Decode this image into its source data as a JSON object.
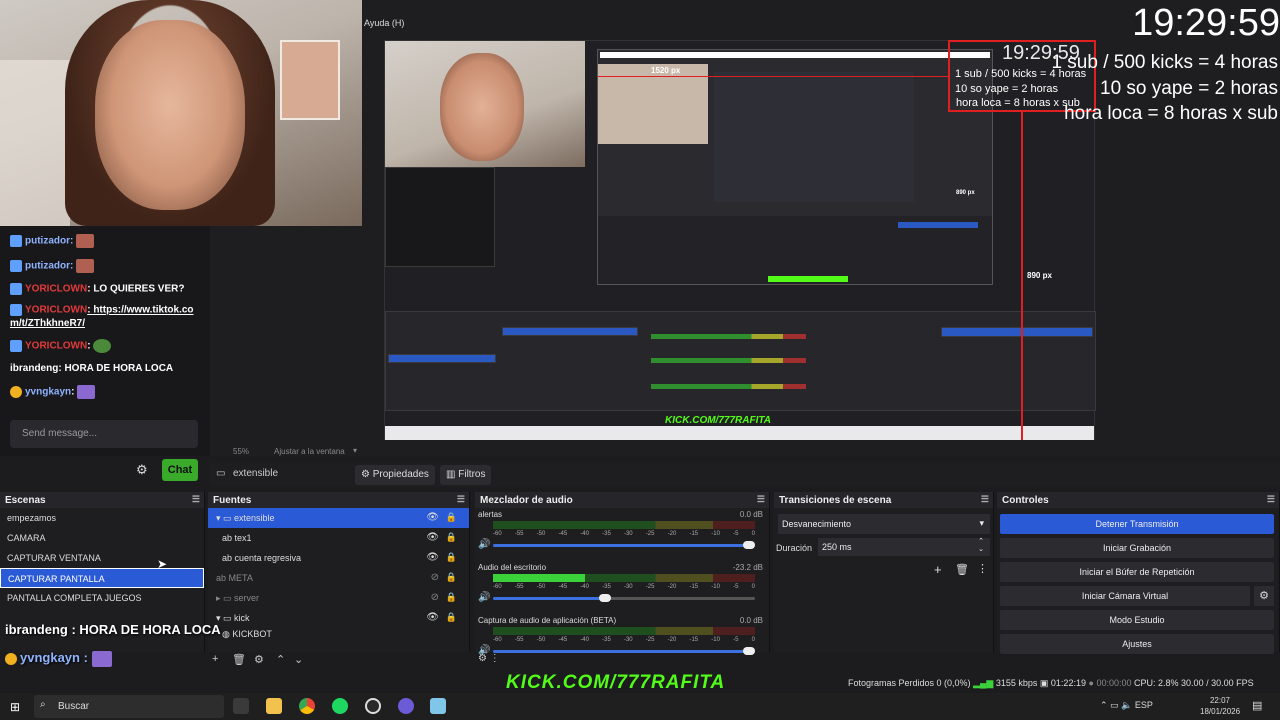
{
  "menubar": {
    "help": "Ayuda (H)"
  },
  "timer": {
    "time": "19:29:59",
    "rule1": "1 sub / 500 kicks = 4 horas",
    "rule2": "10 so yape = 2 horas",
    "rule3": "hora loca = 8 horas x sub"
  },
  "preview_labels": {
    "width_px": "1520 px",
    "height_px": "890 px",
    "height_px_small": "890 px"
  },
  "chat": {
    "messages": [
      {
        "user": "putizador:",
        "text": "",
        "user_color": "#8fb3ff"
      },
      {
        "user": "putizador:",
        "text": "",
        "user_color": "#8fb3ff"
      },
      {
        "user": "YORICLOWN",
        "text": ": LO QUIERES VER?",
        "user_color": "#e23a3a"
      },
      {
        "user": "YORICLOWN",
        "text": ": https://www.tiktok.co",
        "text2": "m/t/ZThkhneR7/",
        "user_color": "#e23a3a"
      },
      {
        "user": "YORICLOWN",
        "text": ":",
        "user_color": "#e23a3a"
      },
      {
        "user": "ibrandeng",
        "text": ": HORA DE HORA LOCA",
        "user_color": "#ffffff"
      },
      {
        "user": "yvngkayn",
        "text": ":",
        "user_color": "#8fb3ff"
      }
    ],
    "send_placeholder": "Send message...",
    "chat_button": "Chat"
  },
  "zoombar": {
    "zoom": "55%",
    "fit": "Ajustar a la ventana"
  },
  "toolbar": {
    "source_name": "extensible",
    "properties": "Propiedades",
    "filters": "Filtros"
  },
  "scenes": {
    "title": "Escenas",
    "items": [
      "empezamos",
      "CAMARA",
      "CAPTURAR VENTANA",
      "CAPTURAR PANTALLA",
      "PANTALLA COMPLETA JUEGOS"
    ],
    "selected_index": 3
  },
  "sources": {
    "title": "Fuentes",
    "items": [
      {
        "name": "extensible",
        "selected": true
      },
      {
        "name": "tex1"
      },
      {
        "name": "cuenta regresiva"
      },
      {
        "name": "META"
      },
      {
        "name": "server"
      },
      {
        "name": "kick"
      },
      {
        "name": "KICKBOT"
      }
    ]
  },
  "mixer": {
    "title": "Mezclador de audio",
    "channels": [
      {
        "name": "alertas",
        "db": "0.0 dB",
        "level": 0.0,
        "volume": 1.0
      },
      {
        "name": "Audio del escritorio",
        "db": "-23.2 dB",
        "level": 0.35,
        "volume": 0.45
      },
      {
        "name": "Captura de audio de aplicación (BETA)",
        "db": "0.0 dB",
        "level": 0.0,
        "volume": 1.0
      }
    ],
    "ticks": [
      "-60",
      "-55",
      "-50",
      "-45",
      "-40",
      "-35",
      "-30",
      "-25",
      "-20",
      "-15",
      "-10",
      "-5",
      "0"
    ]
  },
  "transitions": {
    "title": "Transiciones de escena",
    "type": "Desvanecimiento",
    "duration_label": "Duración",
    "duration_value": "250 ms"
  },
  "controls": {
    "title": "Controles",
    "buttons": [
      "Detener Transmisión",
      "Iniciar Grabación",
      "Iniciar el Búfer de Repetición",
      "Iniciar Cámara Virtual",
      "Modo Estudio",
      "Ajustes"
    ]
  },
  "overlay": {
    "chat_line1": "ibrandeng : HORA DE HORA LOCA",
    "chat_line2_user": "yvngkayn :"
  },
  "status": {
    "kick_brand": "KICK.COM/777RAFITA",
    "dropped": "Fotogramas Perdidos 0 (0,0%)",
    "bitrate": "3155 kbps",
    "live_time": "01:22:19",
    "rec_time": "00:00:00",
    "cpu": "CPU: 2.8%",
    "fps": "30.00 / 30.00 FPS"
  },
  "taskbar": {
    "search": "Buscar",
    "lang": "ESP",
    "time": "22:07",
    "date": "18/01/2026"
  },
  "colors": {
    "accent": "#2a5ad6",
    "kick_green": "#53fc18",
    "alert_red": "#e02020"
  }
}
